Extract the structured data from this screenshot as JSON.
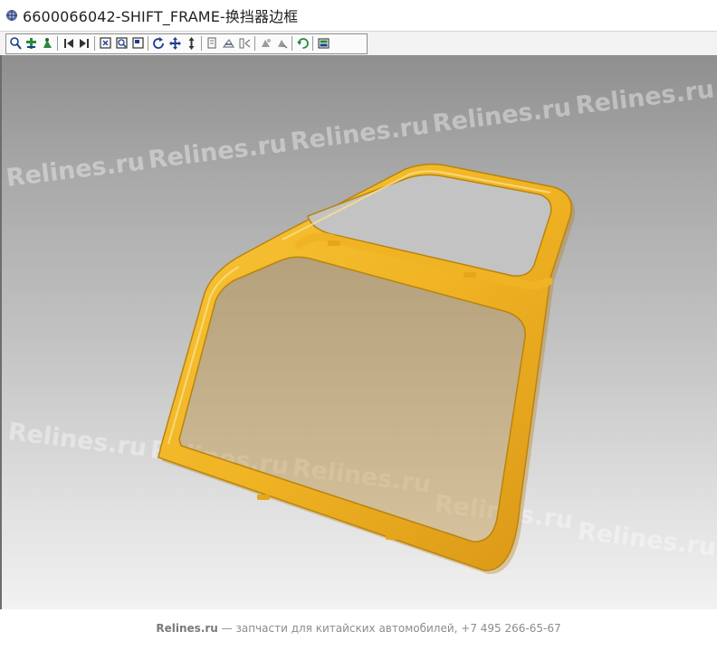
{
  "window": {
    "title": "6600066042-SHIFT_FRAME-换挡器边框",
    "icon": "assembly-icon"
  },
  "toolbar": {
    "buttons": [
      {
        "name": "zoom-icon"
      },
      {
        "name": "pan-tool-icon"
      },
      {
        "name": "select-part-icon"
      },
      {
        "name": "first-step-icon"
      },
      {
        "name": "last-step-icon"
      },
      {
        "name": "fit-all-icon"
      },
      {
        "name": "fit-selection-icon"
      },
      {
        "name": "zoom-window-icon"
      },
      {
        "name": "rotate-icon"
      },
      {
        "name": "move-icon"
      },
      {
        "name": "zoom-vertical-icon"
      },
      {
        "name": "measure-icon"
      },
      {
        "name": "section-icon"
      },
      {
        "name": "explode-icon"
      },
      {
        "name": "hide-icon"
      },
      {
        "name": "show-icon"
      },
      {
        "name": "reset-view-icon"
      },
      {
        "name": "display-mode-icon"
      }
    ]
  },
  "viewport": {
    "model": "shift frame",
    "model_color": "#f0b323",
    "watermark_text": "Relines.ru"
  },
  "footer": {
    "brand": "Relines.ru",
    "text": " — запчасти для китайских автомобилей, +7 495 266-65-67"
  }
}
